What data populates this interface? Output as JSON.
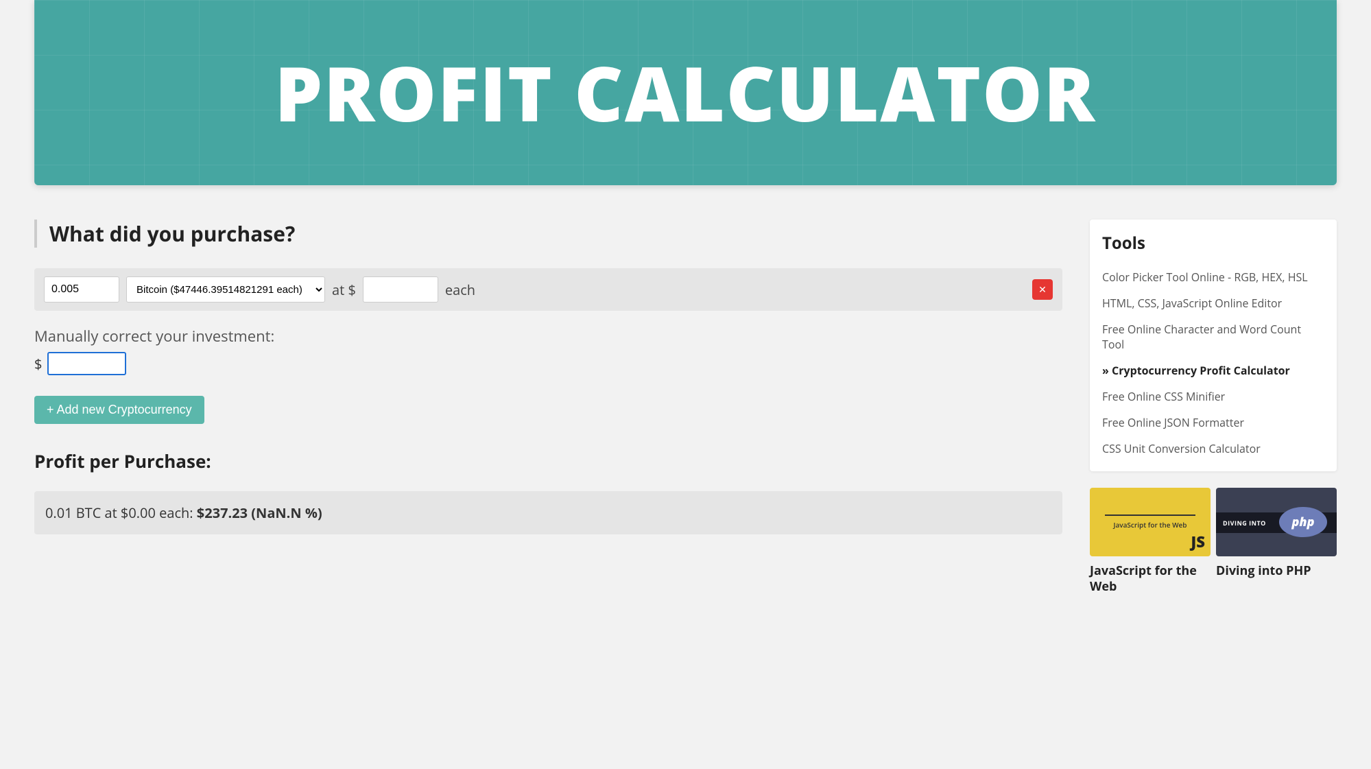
{
  "banner": {
    "title": "PROFIT CALCULATOR"
  },
  "main": {
    "heading": "What did you purchase?",
    "purchase": {
      "quantity": "0.005",
      "crypto_option": "Bitcoin ($47446.39514821291 each)",
      "at_label": "at $",
      "price": "",
      "each_label": "each"
    },
    "manual_label": "Manually correct your investment:",
    "dollar_sign": "$",
    "manual_value": "",
    "add_button": "+ Add new Cryptocurrency",
    "profit_heading": "Profit per Purchase:",
    "profit_line_prefix": "0.01 BTC at $0.00 each:  ",
    "profit_line_bold": "$237.23 (NaN.N %)"
  },
  "sidebar": {
    "tools_title": "Tools",
    "tools": [
      {
        "label": "Color Picker Tool Online - RGB, HEX, HSL",
        "active": false
      },
      {
        "label": "HTML, CSS, JavaScript Online Editor",
        "active": false
      },
      {
        "label": "Free Online Character and Word Count Tool",
        "active": false
      },
      {
        "label": "» Cryptocurrency Profit Calculator",
        "active": true
      },
      {
        "label": "Free Online CSS Minifier",
        "active": false
      },
      {
        "label": "Free Online JSON Formatter",
        "active": false
      },
      {
        "label": "CSS Unit Conversion Calculator",
        "active": false
      }
    ],
    "courses": [
      {
        "title": "JavaScript for the Web",
        "thumb_small": "JavaScript for the Web",
        "thumb_badge": "JS"
      },
      {
        "title": "Diving into PHP",
        "thumb_stripe": "DIVING INTO",
        "thumb_pill": "php"
      }
    ]
  }
}
